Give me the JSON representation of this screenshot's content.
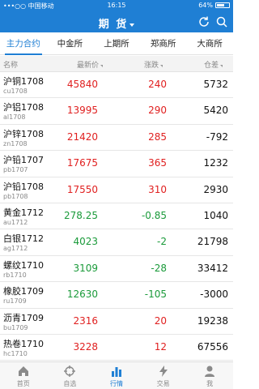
{
  "status_bar": {
    "carrier": "•••○○ 中国移动",
    "time": "16:15",
    "battery": "64%",
    "battery_level": 0.64
  },
  "nav": {
    "title": "期 货"
  },
  "tabs": [
    {
      "label": "主力合约",
      "active": true
    },
    {
      "label": "中金所",
      "active": false
    },
    {
      "label": "上期所",
      "active": false
    },
    {
      "label": "郑商所",
      "active": false
    },
    {
      "label": "大商所",
      "active": false
    }
  ],
  "table": {
    "columns": [
      "名称",
      "最新价",
      "涨跌",
      "仓差"
    ],
    "rows": [
      {
        "name": "沪铜1708",
        "code": "cu1708",
        "price": "45840",
        "change": "240",
        "oi": "5732",
        "dir": "up"
      },
      {
        "name": "沪铝1708",
        "code": "al1708",
        "price": "13995",
        "change": "290",
        "oi": "5420",
        "dir": "up"
      },
      {
        "name": "沪锌1708",
        "code": "zn1708",
        "price": "21420",
        "change": "285",
        "oi": "-792",
        "dir": "up"
      },
      {
        "name": "沪铅1707",
        "code": "pb1707",
        "price": "17675",
        "change": "365",
        "oi": "1232",
        "dir": "up"
      },
      {
        "name": "沪铅1708",
        "code": "pb1708",
        "price": "17550",
        "change": "310",
        "oi": "2930",
        "dir": "up"
      },
      {
        "name": "黄金1712",
        "code": "au1712",
        "price": "278.25",
        "change": "-0.85",
        "oi": "1040",
        "dir": "down"
      },
      {
        "name": "白银1712",
        "code": "ag1712",
        "price": "4023",
        "change": "-2",
        "oi": "21798",
        "dir": "down"
      },
      {
        "name": "螺纹1710",
        "code": "rb1710",
        "price": "3109",
        "change": "-28",
        "oi": "33412",
        "dir": "down"
      },
      {
        "name": "橡胶1709",
        "code": "ru1709",
        "price": "12630",
        "change": "-105",
        "oi": "-3000",
        "dir": "down"
      },
      {
        "name": "沥青1709",
        "code": "bu1709",
        "price": "2316",
        "change": "20",
        "oi": "19238",
        "dir": "up"
      },
      {
        "name": "热卷1710",
        "code": "hc1710",
        "price": "3228",
        "change": "12",
        "oi": "67556",
        "dir": "up"
      }
    ]
  },
  "bottom_nav": [
    {
      "label": "首页",
      "icon": "home-icon",
      "active": false
    },
    {
      "label": "自选",
      "icon": "crosshair-icon",
      "active": false
    },
    {
      "label": "行情",
      "icon": "bar-chart-icon",
      "active": true
    },
    {
      "label": "交易",
      "icon": "lightning-icon",
      "active": false
    },
    {
      "label": "我",
      "icon": "person-icon",
      "active": false
    }
  ],
  "colors": {
    "brand": "#1f7fd4",
    "up": "#e02020",
    "down": "#1a9a3a"
  }
}
